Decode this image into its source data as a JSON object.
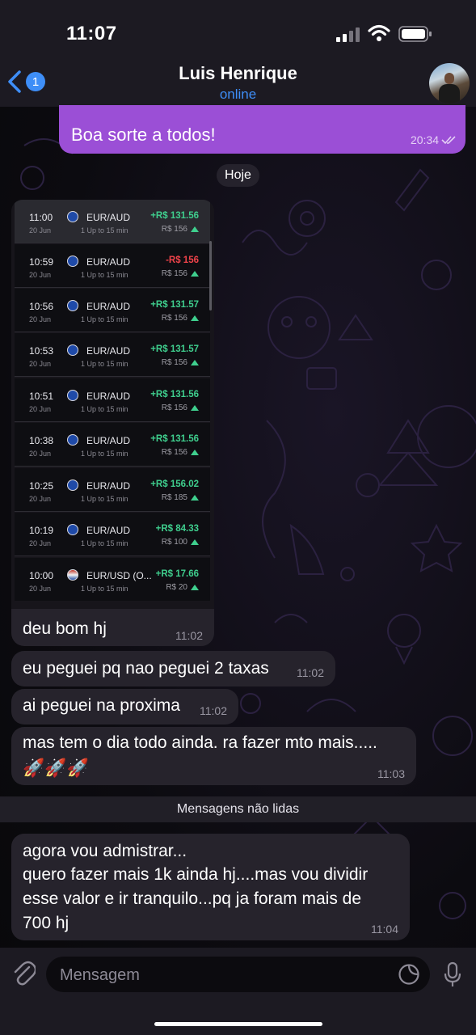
{
  "status_bar": {
    "time": "11:07"
  },
  "header": {
    "back_badge": "1",
    "contact_name": "Luis Henrique",
    "contact_status": "online"
  },
  "outgoing": {
    "text": "Boa sorte a todos!",
    "time": "20:34"
  },
  "date_separator": "Hoje",
  "trades": [
    {
      "time": "11:00",
      "date": "20 Jun",
      "pair": "EUR/AUD",
      "duration": "1 Up to 15 min",
      "result": "+R$ 131.56",
      "investment": "R$ 156",
      "positive": true,
      "flag": "aud"
    },
    {
      "time": "10:59",
      "date": "20 Jun",
      "pair": "EUR/AUD",
      "duration": "1 Up to 15 min",
      "result": "-R$ 156",
      "investment": "R$ 156",
      "positive": false,
      "flag": "aud"
    },
    {
      "time": "10:56",
      "date": "20 Jun",
      "pair": "EUR/AUD",
      "duration": "1 Up to 15 min",
      "result": "+R$ 131.57",
      "investment": "R$ 156",
      "positive": true,
      "flag": "aud"
    },
    {
      "time": "10:53",
      "date": "20 Jun",
      "pair": "EUR/AUD",
      "duration": "1 Up to 15 min",
      "result": "+R$ 131.57",
      "investment": "R$ 156",
      "positive": true,
      "flag": "aud"
    },
    {
      "time": "10:51",
      "date": "20 Jun",
      "pair": "EUR/AUD",
      "duration": "1 Up to 15 min",
      "result": "+R$ 131.56",
      "investment": "R$ 156",
      "positive": true,
      "flag": "aud"
    },
    {
      "time": "10:38",
      "date": "20 Jun",
      "pair": "EUR/AUD",
      "duration": "1 Up to 15 min",
      "result": "+R$ 131.56",
      "investment": "R$ 156",
      "positive": true,
      "flag": "aud"
    },
    {
      "time": "10:25",
      "date": "20 Jun",
      "pair": "EUR/AUD",
      "duration": "1 Up to 15 min",
      "result": "+R$ 156.02",
      "investment": "R$ 185",
      "positive": true,
      "flag": "aud"
    },
    {
      "time": "10:19",
      "date": "20 Jun",
      "pair": "EUR/AUD",
      "duration": "1 Up to 15 min",
      "result": "+R$ 84.33",
      "investment": "R$ 100",
      "positive": true,
      "flag": "aud"
    },
    {
      "time": "10:00",
      "date": "20 Jun",
      "pair": "EUR/USD (O...",
      "duration": "1 Up to 15 min",
      "result": "+R$ 17.66",
      "investment": "R$ 20",
      "positive": true,
      "flag": "usd"
    }
  ],
  "messages": [
    {
      "text": "deu bom hj",
      "time": "11:02"
    },
    {
      "text": "eu peguei pq nao peguei 2 taxas",
      "time": "11:02"
    },
    {
      "text": "ai peguei na proxima",
      "time": "11:02"
    },
    {
      "text": "mas tem o dia todo ainda. ra fazer mto mais.....",
      "emoji": "🚀🚀🚀",
      "time": "11:03"
    }
  ],
  "unread_divider": "Mensagens não lidas",
  "last_message": {
    "lines": [
      "agora vou admistrar...",
      "quero fazer mais 1k ainda hj....mas vou dividir",
      "esse valor e ir tranquilo...pq ja foram mais de",
      "700 hj"
    ],
    "time": "11:04"
  },
  "input": {
    "placeholder": "Mensagem"
  },
  "colors": {
    "accent": "#3e8ef7",
    "outgoing_bubble": "#9b4fd6",
    "incoming_bubble": "#26232c",
    "profit": "#3fcf8e",
    "loss": "#f0434a"
  }
}
